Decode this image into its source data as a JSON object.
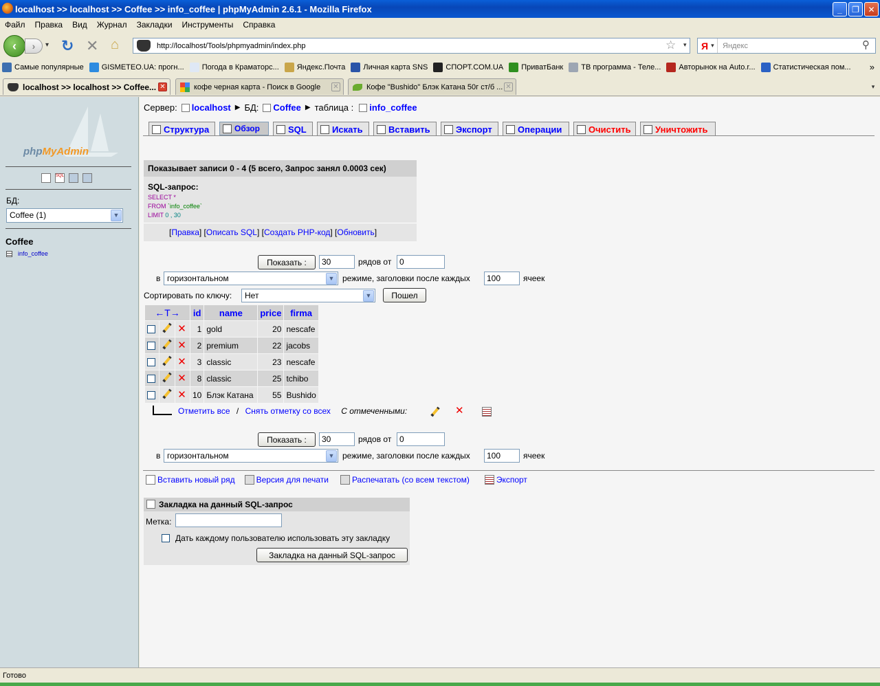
{
  "window": {
    "title": "localhost >> localhost >> Coffee  >> info_coffee | phpMyAdmin 2.6.1 - Mozilla Firefox"
  },
  "menu": [
    "Файл",
    "Правка",
    "Вид",
    "Журнал",
    "Закладки",
    "Инструменты",
    "Справка"
  ],
  "nav": {
    "url": "http://localhost/Tools/phpmyadmin/index.php",
    "search_placeholder": "Яндекс",
    "search_engine": "Я"
  },
  "bookmarks": [
    {
      "label": "Самые популярные",
      "icon": "folder-icon",
      "color": "#3d6fb0"
    },
    {
      "label": "GISMETEO.UA: прогн...",
      "icon": "drop-icon",
      "color": "#2d8be0"
    },
    {
      "label": "Погода в Краматорс...",
      "icon": "page-icon",
      "color": "#dfe8f5"
    },
    {
      "label": "Яндекс.Почта",
      "icon": "envelope-icon",
      "color": "#c9a64a"
    },
    {
      "label": "Личная карта SNS",
      "icon": "s-icon",
      "color": "#2a54a8"
    },
    {
      "label": "СПОРТ.COM.UA",
      "icon": "ball-icon",
      "color": "#222"
    },
    {
      "label": "ПриватБанк",
      "icon": "privat-icon",
      "color": "#2f8f1f"
    },
    {
      "label": "ТВ программа - Теле...",
      "icon": "tv-icon",
      "color": "#9da6b3"
    },
    {
      "label": "Авторынок на Auto.r...",
      "icon": "car-icon",
      "color": "#b5271e"
    },
    {
      "label": "Статистическая пом...",
      "icon": "alpha-icon",
      "color": "#2b61c4"
    }
  ],
  "tabs": [
    {
      "label": "localhost >> localhost >> Coffee...",
      "active": true
    },
    {
      "label": "кофе черная карта - Поиск в Google",
      "active": false
    },
    {
      "label": "Кофе \"Bushido\" Блэк Катана 50г ст/б ...",
      "active": false
    }
  ],
  "left": {
    "logo_php": "php",
    "logo_myadmin": "MyAdmin",
    "db_label": "БД:",
    "db_selected": "Coffee (1)",
    "db_title": "Coffee",
    "table_link": "info_coffee"
  },
  "breadcrumb": {
    "server_label": "Сервер:",
    "server": "localhost",
    "db_label": "БД:",
    "db": "Coffee",
    "table_label": "таблица :",
    "table": "info_coffee"
  },
  "main_tabs": [
    {
      "label": "Структура",
      "selected": false,
      "red": false
    },
    {
      "label": "Обзор",
      "selected": true,
      "red": false
    },
    {
      "label": "SQL",
      "selected": false,
      "red": false
    },
    {
      "label": "Искать",
      "selected": false,
      "red": false
    },
    {
      "label": "Вставить",
      "selected": false,
      "red": false
    },
    {
      "label": "Экспорт",
      "selected": false,
      "red": false
    },
    {
      "label": "Операции",
      "selected": false,
      "red": false
    },
    {
      "label": "Очистить",
      "selected": false,
      "red": true
    },
    {
      "label": "Уничтожить",
      "selected": false,
      "red": true
    }
  ],
  "info": {
    "header": "Показывает записи 0 - 4 (5 всего, Запрос занял 0.0003 сек)",
    "sql_label": "SQL-запрос:",
    "sql_line1_kw": "SELECT",
    "sql_line1_rest": " *",
    "sql_line2_kw": "FROM",
    "sql_line2_rest": " `info_coffee`",
    "sql_line3_kw": "LIMIT",
    "sql_line3_rest": " 0 , 30",
    "links": [
      "Правка",
      "Описать SQL",
      "Создать PHP-код",
      "Обновить"
    ]
  },
  "paging": {
    "show_button": "Показать :",
    "rows_value": "30",
    "rows_from_label": "рядов от",
    "from_value": "0",
    "in_label": "в",
    "mode_value": "горизонтальном",
    "mode_suffix": "режиме, заголовки после каждых",
    "cells_value": "100",
    "cells_label": "ячеек"
  },
  "sort": {
    "label": "Сортировать по ключу:",
    "value": "Нет",
    "go_button": "Пошел"
  },
  "table": {
    "columns": [
      "id",
      "name",
      "price",
      "firma"
    ],
    "rows": [
      {
        "id": "1",
        "name": "gold",
        "price": "20",
        "firma": "nescafe"
      },
      {
        "id": "2",
        "name": "premium",
        "price": "22",
        "firma": "jacobs"
      },
      {
        "id": "3",
        "name": "classic",
        "price": "23",
        "firma": "nescafe"
      },
      {
        "id": "8",
        "name": "classic",
        "price": "25",
        "firma": "tchibo"
      },
      {
        "id": "10",
        "name": "Блэк Катана",
        "price": "55",
        "firma": "Bushido"
      }
    ]
  },
  "checkall": {
    "check": "Отметить все",
    "sep": "/",
    "uncheck": "Снять отметку со всех",
    "with_selected": "С отмеченными:"
  },
  "actions": {
    "insert": "Вставить новый ряд",
    "print": "Версия для печати",
    "print_full": "Распечатать (со всем текстом)",
    "export": "Экспорт"
  },
  "bookmark_section": {
    "header": "Закладка на данный SQL-запрос",
    "label": "Метка:",
    "label_value": "",
    "checkbox_label": "Дать каждому пользователю использовать эту закладку",
    "submit": "Закладка на данный SQL-запрос"
  },
  "status": "Готово"
}
